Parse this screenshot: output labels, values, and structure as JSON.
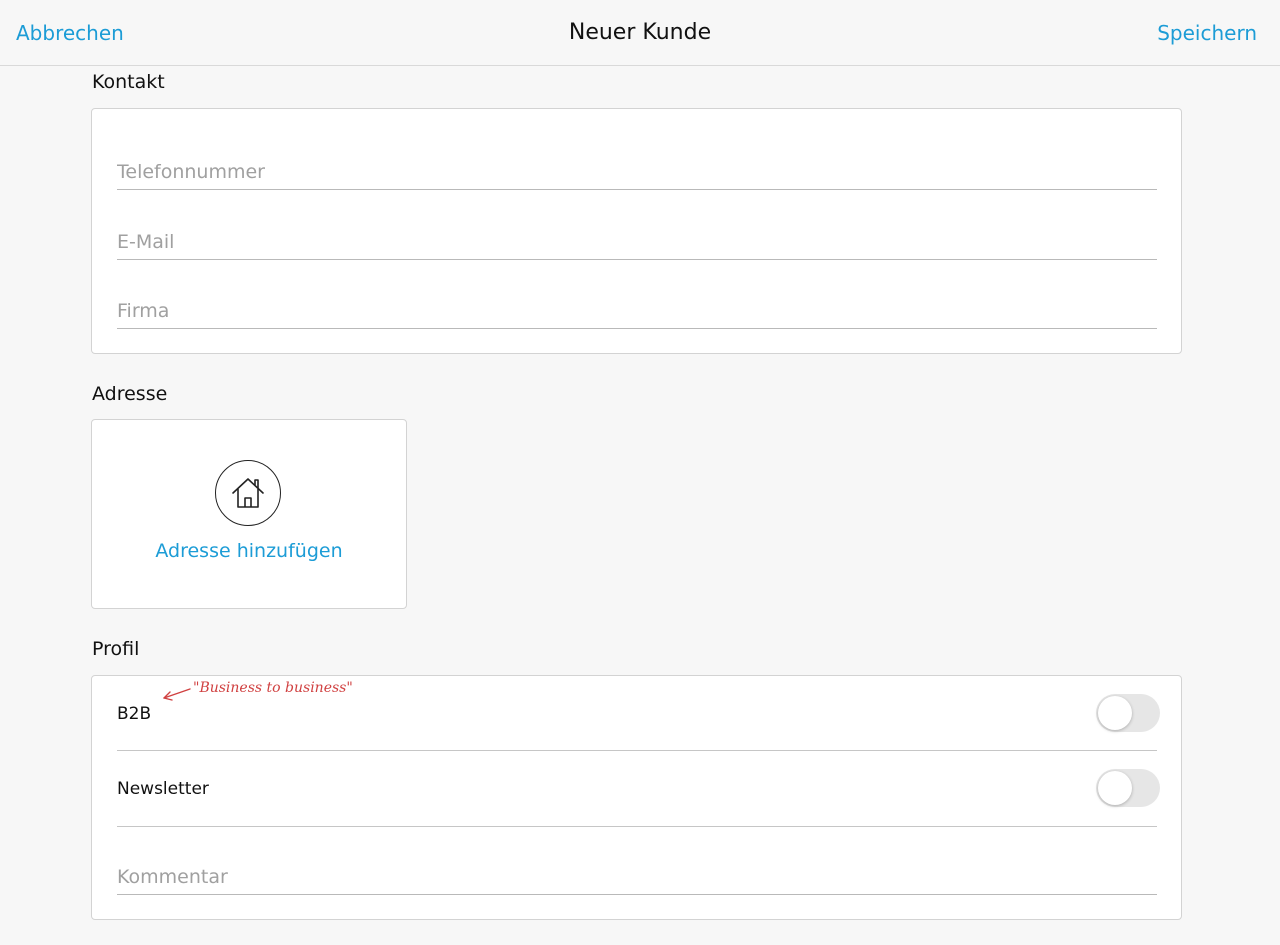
{
  "navbar": {
    "cancel_label": "Abbrechen",
    "title": "Neuer Kunde",
    "save_label": "Speichern",
    "accent_color": "#1c9cd6"
  },
  "contact": {
    "title": "Kontakt",
    "phone_placeholder": "Telefonnummer",
    "phone_value": "",
    "email_placeholder": "E-Mail",
    "email_value": "",
    "company_placeholder": "Firma",
    "company_value": ""
  },
  "address": {
    "title": "Adresse",
    "icon": "house-icon",
    "add_label": "Adresse hinzufügen"
  },
  "profile": {
    "title": "Profil",
    "b2b_label": "B2B",
    "b2b_on": false,
    "b2b_annotation": "\"Business to business\"",
    "newsletter_label": "Newsletter",
    "newsletter_on": false,
    "comment_placeholder": "Kommentar",
    "comment_value": ""
  }
}
